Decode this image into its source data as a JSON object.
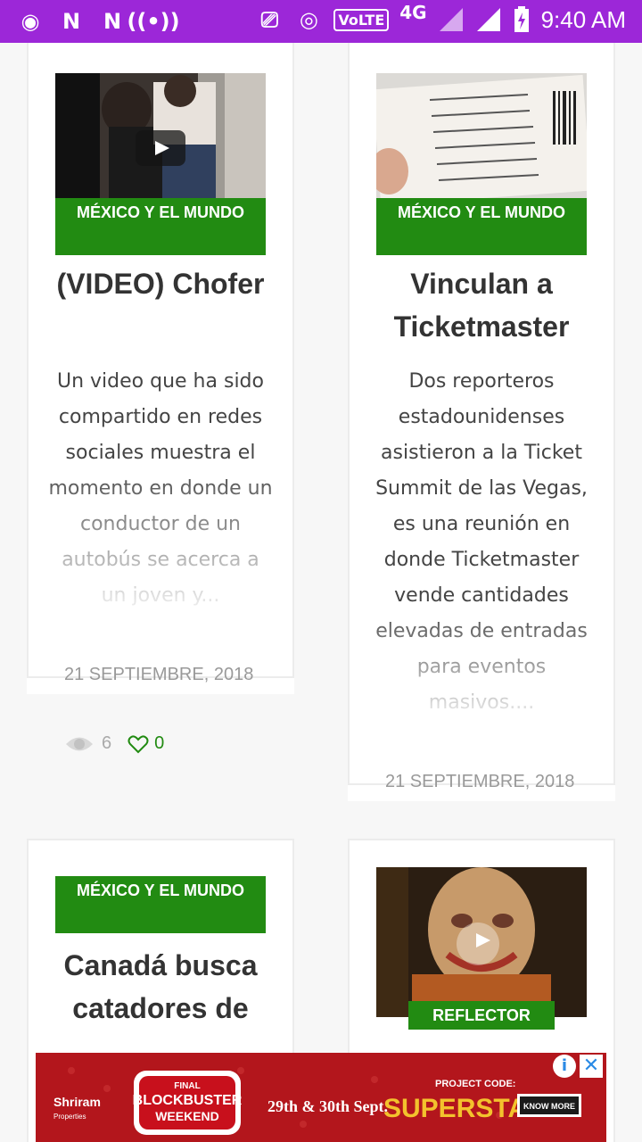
{
  "status_bar": {
    "time": "9:40 AM",
    "network": "4G",
    "volte": "VoLTE",
    "icons": [
      "radio-icon",
      "n-app-icon",
      "n-app-icon",
      "hotspot-icon",
      "cast-icon",
      "wifi-hotspot-icon",
      "volte-icon",
      "signal-icon",
      "signal-icon",
      "battery-charging-icon"
    ]
  },
  "cards": [
    {
      "category": "MÉXICO Y EL MUNDO",
      "title": "(VIDEO) Chofer",
      "excerpt": "Un video que ha sido compartido en redes sociales muestra el momento en donde un conductor de un autobús se acerca a un joven y...",
      "date": "21 SEPTIEMBRE, 2018",
      "views": "6",
      "likes": "0"
    },
    {
      "category": "MÉXICO Y EL MUNDO",
      "title": "Vinculan a Ticketmaster",
      "excerpt": "Dos reporteros estadounidenses asistieron a la Ticket Summit de las Vegas, es una reunión en donde Ticketmaster vende cantidades elevadas de entradas para eventos masivos....",
      "date": "21 SEPTIEMBRE, 2018"
    },
    {
      "category": "MÉXICO Y EL MUNDO",
      "title": "Canadá busca catadores de"
    },
    {
      "category": "REFLECTOR"
    }
  ],
  "ad": {
    "brand": "Shriram Properties",
    "event_small": "FINAL",
    "event_title": "BLOCKBUSTER",
    "event_sub": "WEEKEND",
    "dates": "29th & 30th Sept.",
    "project_label": "PROJECT CODE:",
    "project_name": "SUPERSTAR",
    "cta": "KNOW MORE",
    "info_icon": "i",
    "close_icon": "✕"
  }
}
